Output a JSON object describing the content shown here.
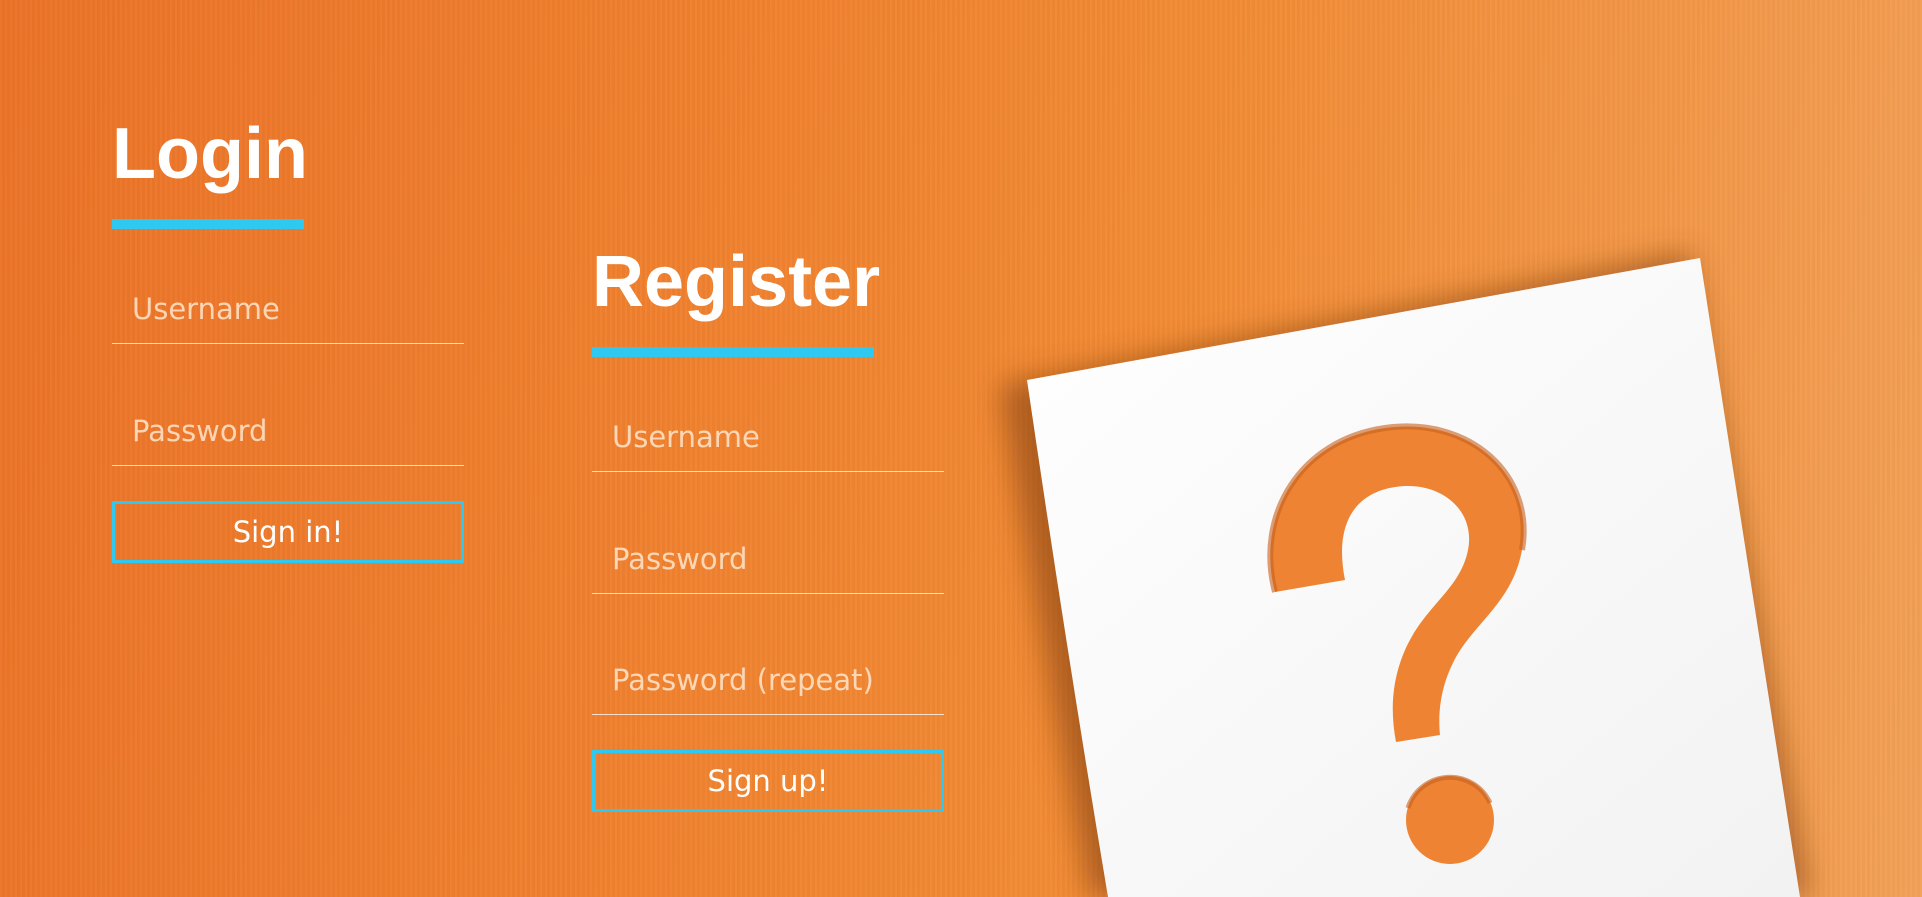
{
  "colors": {
    "accent": "#2ec8f0",
    "background": "#f0812f",
    "text": "#ffffff"
  },
  "login": {
    "title": "Login",
    "username_placeholder": "Username",
    "password_placeholder": "Password",
    "submit_label": "Sign in!"
  },
  "register": {
    "title": "Register",
    "username_placeholder": "Username",
    "password_placeholder": "Password",
    "password_repeat_placeholder": "Password (repeat)",
    "submit_label": "Sign up!"
  },
  "illustration": {
    "icon": "question-mark-icon"
  }
}
